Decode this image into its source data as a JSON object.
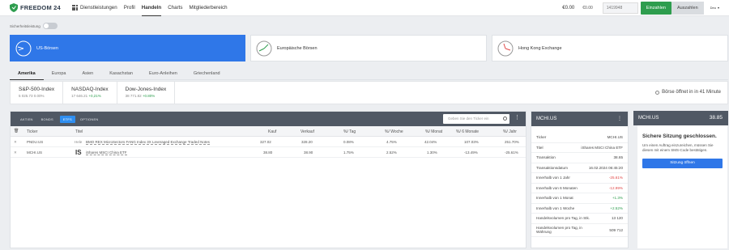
{
  "brand": {
    "name": "FREEDOM 24"
  },
  "nav": {
    "items": [
      "Dienstleistungen",
      "Profil",
      "Handeln",
      "Charts",
      "Mitgliederbereich"
    ],
    "active": "Handeln"
  },
  "header": {
    "balance": "€0.00",
    "balance_small": "€0.00",
    "account": "1419948",
    "deposit_label": "Einzahlen",
    "withdraw_label": "Auszahlen",
    "language": "Deu"
  },
  "security": {
    "label": "Sicherheitsleistung"
  },
  "exchanges": [
    {
      "label": "US-Börsen",
      "active": true
    },
    {
      "label": "Europäische Börsen",
      "active": false
    },
    {
      "label": "Hong Kong Exchange",
      "active": false
    }
  ],
  "region_tabs": [
    "Amerika",
    "Europa",
    "Asien",
    "Kasachstan",
    "Euro-Anleihen",
    "Griechenland"
  ],
  "indices": [
    {
      "name": "S&P-500-Index",
      "value": "5 025.73",
      "change": "0.00%",
      "status": "neutral"
    },
    {
      "name": "NASDAQ-Index",
      "value": "17 646.21",
      "change": "+0,21%",
      "status": "positive"
    },
    {
      "name": "Dow-Jones-Index",
      "value": "38 771.82",
      "change": "+0.80%",
      "status": "positive"
    }
  ],
  "market_status": "Börse öffnet in in 41 Minute",
  "watchlist": {
    "tabs": [
      "AKTIEN",
      "BONDS",
      "ETFS",
      "OPTIONEN"
    ],
    "active_tab": "ETFS",
    "search_placeholder": "Geben Sie den Ticker ein",
    "columns": [
      "Ticker",
      "Titel",
      "Kauf",
      "Verkauf",
      "%/ Tag",
      "%/ Woche",
      "%/ Monat",
      "%/ 6 Monate",
      "%/ Jahr"
    ],
    "rows": [
      {
        "ticker": "PNDU.US",
        "logo": "Hele",
        "title": "BMO REX MicroSectors FANG Index 3X Leveraged Exchange Traded Notes",
        "kauf": "327.02",
        "verkauf": "328.20",
        "tag": "0.08%",
        "woche": "4.75%",
        "monat": "42.04%",
        "sechs": "107.03%",
        "jahr": "251.70%"
      },
      {
        "ticker": "MCHI.US",
        "logo": "IS",
        "title": "iShares MSCI China ETF",
        "kauf": "38.80",
        "verkauf": "38.90",
        "tag": "1.75%",
        "woche": "2.52%",
        "monat": "1.30%",
        "sechs": "-13.49%",
        "jahr": "-25.61%"
      }
    ]
  },
  "detail": {
    "title": "MCHI.US",
    "rows": [
      {
        "key": "Ticker",
        "value": "MCHI.US",
        "status": "neutral"
      },
      {
        "key": "Titel",
        "value": "iShares MSCI China ETF",
        "status": "neutral"
      },
      {
        "key": "Transaktion",
        "value": "38.65",
        "status": "neutral"
      },
      {
        "key": "Transaktionsdatum",
        "value": "16.02.2024 06:45:20",
        "status": "neutral"
      },
      {
        "key": "Innerhalb von 1 Jahr",
        "value": "-25.61%",
        "status": "negative"
      },
      {
        "key": "Innerhalb von 6 Monaten",
        "value": "-12.99%",
        "status": "negative"
      },
      {
        "key": "Innerhalb von 1 Monat",
        "value": "+1.3%",
        "status": "positive"
      },
      {
        "key": "Innerhalb von 1 Woche",
        "value": "+2.52%",
        "status": "positive"
      },
      {
        "key": "Handelsvolumen pro Tag, in Stk.",
        "value": "13 120",
        "status": "neutral"
      },
      {
        "key": "Handelsvolumen pro Tag, in Währung",
        "value": "509 712",
        "status": "neutral"
      }
    ]
  },
  "order": {
    "title": "MCHI.US",
    "price": "38.85",
    "session_title": "Sichere Sitzung geschlossen.",
    "session_text": "Um einen Auftrag einzureichen, müssen Sie diesen mit einem SMS-Code bestätigen.",
    "button_label": "Sitzung öffnen"
  },
  "colors": {
    "accent": "#2f77e8",
    "positive": "#2e9d4e",
    "negative": "#e04848",
    "header_dark": "#505864"
  }
}
